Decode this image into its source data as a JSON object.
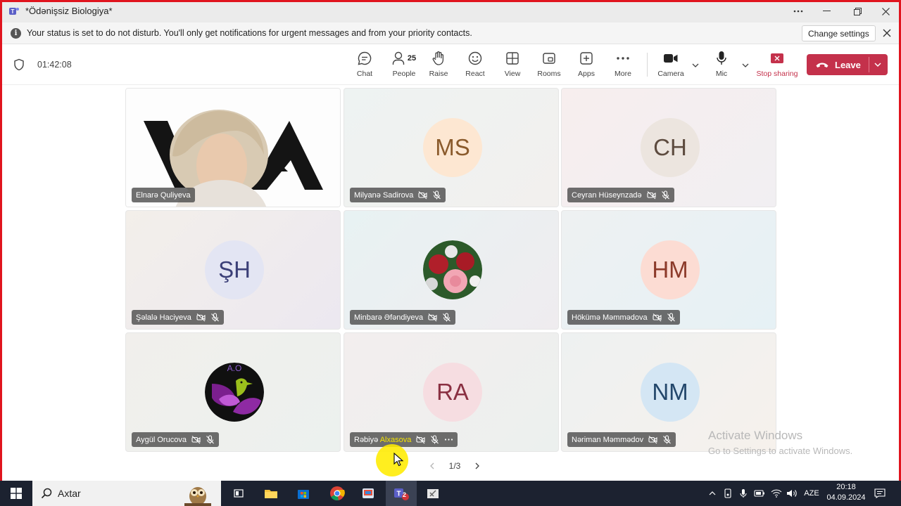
{
  "window": {
    "title": "*Ödənişsiz Biologiya*",
    "controls": [
      "more-options",
      "minimize",
      "maximize",
      "close"
    ]
  },
  "notification": {
    "message": "Your status is set to do not disturb. You'll only get notifications for urgent messages and from your priority contacts.",
    "button": "Change settings"
  },
  "meeting": {
    "elapsed": "01:42:08",
    "toolbar": {
      "chat": "Chat",
      "people": "People",
      "people_count": "25",
      "raise": "Raise",
      "react": "React",
      "view": "View",
      "rooms": "Rooms",
      "apps": "Apps",
      "more": "More",
      "camera": "Camera",
      "mic": "Mic",
      "stop_sharing": "Stop sharing",
      "leave": "Leave"
    }
  },
  "participants": [
    {
      "name": "Elnarə Quliyeva",
      "type": "video"
    },
    {
      "name": "Milyanə Sadirova",
      "initials": "MS",
      "bg": "#fde7d2",
      "fg": "#8a5a2b"
    },
    {
      "name": "Ceyran Hüseynzadə",
      "initials": "CH",
      "bg": "#ece5df",
      "fg": "#5d4b3f"
    },
    {
      "name": "Şəlalə Haciyeva",
      "initials": "ŞH",
      "bg": "#e3e5f3",
      "fg": "#3b3f77"
    },
    {
      "name": "Minbarə Əfəndiyeva",
      "type": "photo-flowers"
    },
    {
      "name": "Hökümə Məmmədova",
      "initials": "HM",
      "bg": "#fcdcd3",
      "fg": "#8c3a2a"
    },
    {
      "name": "Aygül Orucova",
      "type": "photo-bird"
    },
    {
      "name_part1": "Rəbiyə ",
      "name_part2": "Alxasova",
      "initials": "RA",
      "bg": "#f6dde1",
      "fg": "#8a3042"
    },
    {
      "name": "Nəriman Məmmədov",
      "initials": "NM",
      "bg": "#d4e6f4",
      "fg": "#23476b"
    }
  ],
  "pager": {
    "label": "1/3"
  },
  "watermark": {
    "line1": "Activate Windows",
    "line2": "Go to Settings to activate Windows."
  },
  "taskbar": {
    "search_placeholder": "Axtar",
    "teams_badge": "2",
    "language": "AZE",
    "time": "20:18",
    "date": "04.09.2024"
  },
  "colors": {
    "leave_red": "#c4314b",
    "stop_sharing_red": "#c4314b",
    "frame_red": "#e0141e",
    "teams_purple": "#5b5fc7"
  }
}
